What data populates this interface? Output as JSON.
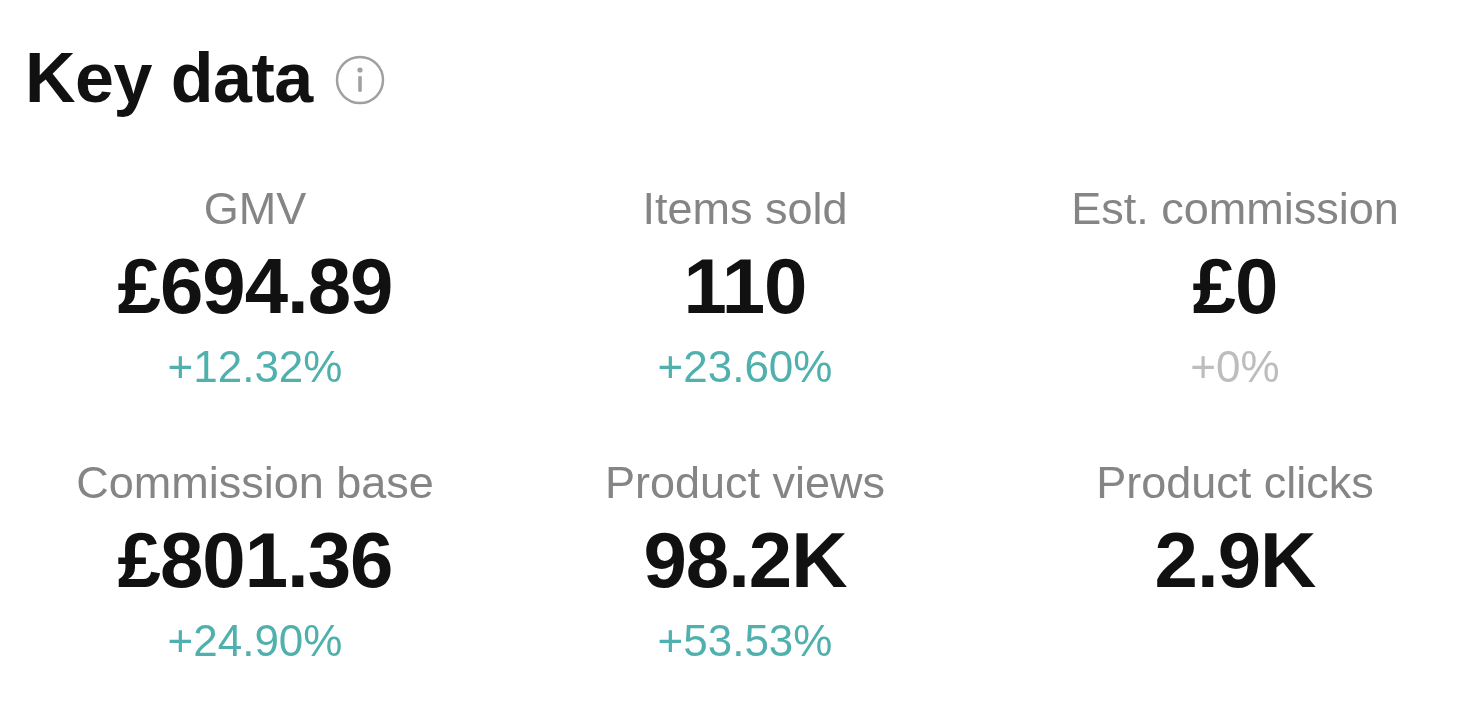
{
  "title": "Key data",
  "metrics": [
    {
      "label": "GMV",
      "value": "£694.89",
      "change": {
        "text": "+12.32%",
        "color": "#4fb0ad"
      }
    },
    {
      "label": "Items sold",
      "value": "110",
      "change": {
        "text": "+23.60%",
        "color": "#4fb0ad"
      }
    },
    {
      "label": "Est. commission",
      "value": "£0",
      "change": {
        "text": "+0%",
        "color": "#bdbdbd"
      }
    },
    {
      "label": "Commission base",
      "value": "£801.36",
      "change": {
        "text": "+24.90%",
        "color": "#4fb0ad"
      }
    },
    {
      "label": "Product views",
      "value": "98.2K",
      "change": {
        "text": "+53.53%",
        "color": "#4fb0ad"
      }
    },
    {
      "label": "Product clicks",
      "value": "2.9K"
    }
  ]
}
